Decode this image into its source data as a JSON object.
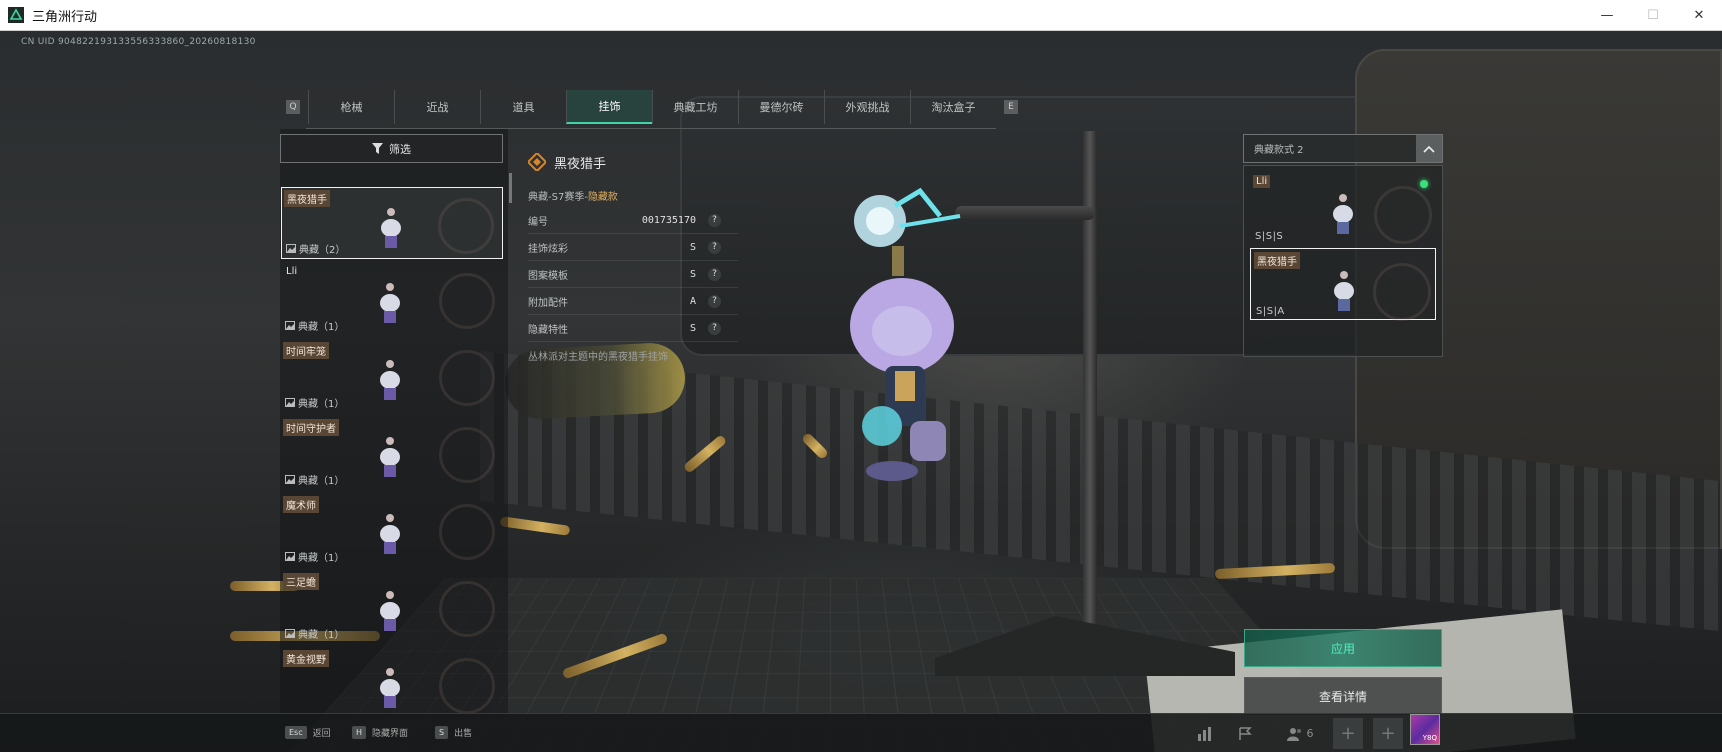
{
  "window": {
    "title": "三角洲行动",
    "min": "—",
    "max": "☐",
    "close": "✕"
  },
  "uid": "CN UID 904822193133556333860_20260818130",
  "tabs": {
    "left_key": "Q",
    "right_key": "E",
    "items": [
      "枪械",
      "近战",
      "道具",
      "挂饰",
      "典藏工坊",
      "曼德尔砖",
      "外观挑战",
      "淘汰盒子"
    ],
    "active": "挂饰"
  },
  "filter": {
    "label": "筛选"
  },
  "items": [
    {
      "name": "黑夜猎手",
      "count": "典藏（2）",
      "tagged": true,
      "selected": true
    },
    {
      "name": "Lli",
      "count": "典藏（1）",
      "tagged": false,
      "selected": false
    },
    {
      "name": "时间牢笼",
      "count": "典藏（1）",
      "tagged": true,
      "selected": false
    },
    {
      "name": "时间守护者",
      "count": "典藏（1）",
      "tagged": true,
      "selected": false
    },
    {
      "name": "魔术师",
      "count": "典藏（1）",
      "tagged": true,
      "selected": false
    },
    {
      "name": "三足蟾",
      "count": "典藏（1）",
      "tagged": true,
      "selected": false
    },
    {
      "name": "黄金视野",
      "count": "",
      "tagged": true,
      "selected": false
    }
  ],
  "detail": {
    "title": "黑夜猎手",
    "subtitle_prefix": "典藏-S7赛季-",
    "subtitle_tag": "隐藏款",
    "rows": [
      {
        "label": "编号",
        "value": "001735170"
      },
      {
        "label": "挂饰炫彩",
        "value": "S"
      },
      {
        "label": "图案模板",
        "value": "S"
      },
      {
        "label": "附加配件",
        "value": "A"
      },
      {
        "label": "隐藏特性",
        "value": "S"
      }
    ],
    "desc": "丛林派对主题中的黑夜猎手挂饰"
  },
  "variants": {
    "dropdown": "典藏款式 2",
    "items": [
      {
        "name": "Lli",
        "grade": "S|S|S",
        "active": true,
        "selected": false
      },
      {
        "name": "黑夜猎手",
        "grade": "S|S|A",
        "active": false,
        "selected": true
      }
    ]
  },
  "buttons": {
    "apply": "应用",
    "details": "查看详情"
  },
  "bottom": {
    "hints": [
      {
        "key": "Esc",
        "label": "返回"
      },
      {
        "key": "H",
        "label": "隐藏界面"
      },
      {
        "key": "S",
        "label": "出售"
      }
    ],
    "squad_count": "6",
    "avatar_text": "Y8Q"
  },
  "colors": {
    "accent": "#3ed6a8",
    "apply_text": "#4ff0c0",
    "tag_bg": "#5a4635",
    "online": "#3be07a"
  }
}
